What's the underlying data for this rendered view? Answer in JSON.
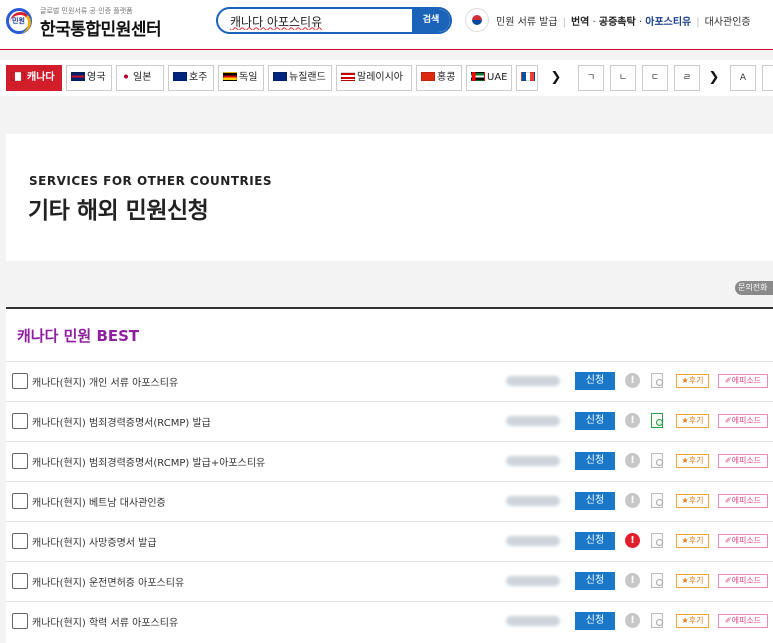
{
  "header": {
    "logo_badge": "민원",
    "logo_small": "글로벌 민원서류 공·인증 플랫폼",
    "logo_main": "한국통합민원센터",
    "search_value": "캐나다 아포스티유",
    "search_button": "검색",
    "nav": [
      "민원 서류 발급",
      "번역",
      "공증촉탁",
      "아포스티유",
      "대사관인증"
    ]
  },
  "country_tabs": [
    {
      "label": "캐나다",
      "flag": "canada-flag",
      "active": true
    },
    {
      "label": "영국",
      "flag": "uk-flag",
      "active": false
    },
    {
      "label": "일본",
      "flag": "japan-flag",
      "active": false
    },
    {
      "label": "호주",
      "flag": "australia-flag",
      "active": false
    },
    {
      "label": "독일",
      "flag": "germany-flag",
      "active": false
    },
    {
      "label": "뉴질랜드",
      "flag": "new-zealand-flag",
      "active": false
    },
    {
      "label": "말레이시아",
      "flag": "malaysia-flag",
      "active": false
    },
    {
      "label": "홍콩",
      "flag": "hong-kong-flag",
      "active": false
    },
    {
      "label": "UAE",
      "flag": "uae-flag",
      "active": false
    },
    {
      "label": "",
      "flag": "france-flag",
      "active": false
    }
  ],
  "index_keys": [
    "ㄱ",
    "ㄴ",
    "ㄷ",
    "ㄹ",
    "A"
  ],
  "arrows": {
    "next": "❯"
  },
  "hero": {
    "subtitle": "SERVICES FOR OTHER COUNTRIES",
    "title": "기타 해외 민원신청"
  },
  "inquiry_label": "문의전화",
  "section": {
    "title": "캐나다 민원 BEST",
    "apply_label": "신청",
    "review_label": "★후기",
    "episode_label": "✐에피소드",
    "items": [
      {
        "label": "캐나다(현지) 개인 서류 아포스티유",
        "alert": false,
        "doc_highlight": false
      },
      {
        "label": "캐나다(현지) 범죄경력증명서(RCMP) 발급",
        "alert": false,
        "doc_highlight": true
      },
      {
        "label": "캐나다(현지) 범죄경력증명서(RCMP) 발급+아포스티유",
        "alert": false,
        "doc_highlight": false
      },
      {
        "label": "캐나다(현지) 베트남 대사관인증",
        "alert": false,
        "doc_highlight": false
      },
      {
        "label": "캐나다(현지) 사망증명서 발급",
        "alert": true,
        "doc_highlight": false
      },
      {
        "label": "캐나다(현지) 운전면허증 아포스티유",
        "alert": false,
        "doc_highlight": false
      },
      {
        "label": "캐나다(현지) 학력 서류 아포스티유",
        "alert": false,
        "doc_highlight": false
      }
    ]
  }
}
